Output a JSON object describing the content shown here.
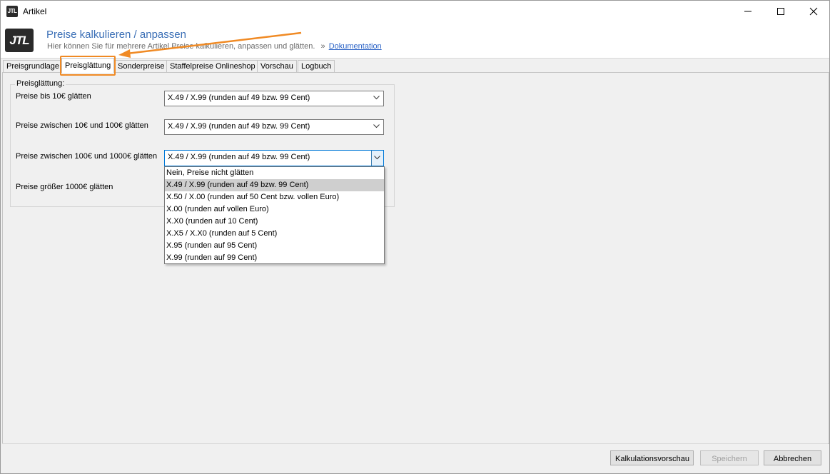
{
  "window": {
    "title": "Artikel",
    "icon": "JTL"
  },
  "header": {
    "logo": "JTL",
    "title": "Preise kalkulieren / anpassen",
    "subtitle": "Hier können Sie für mehrere Artikel Preise kalkulieren, anpassen und glätten.",
    "separator": "»",
    "doc_link": "Dokumentation"
  },
  "tabs": [
    {
      "label": "Preisgrundlage"
    },
    {
      "label": "Preisglättung"
    },
    {
      "label": "Sonderpreise"
    },
    {
      "label": "Staffelpreise Onlineshop"
    },
    {
      "label": "Vorschau"
    },
    {
      "label": "Logbuch"
    }
  ],
  "active_tab": "Preisglättung",
  "group": {
    "legend": "Preisglättung:",
    "rows": [
      {
        "label": "Preise bis 10€ glätten",
        "value": "X.49 / X.99 (runden auf 49 bzw. 99 Cent)"
      },
      {
        "label": "Preise zwischen 10€ und 100€ glätten",
        "value": "X.49 / X.99 (runden auf 49 bzw. 99 Cent)"
      },
      {
        "label": "Preise zwischen 100€ und 1000€ glätten",
        "value": "X.49 / X.99 (runden auf 49 bzw. 99 Cent)"
      },
      {
        "label": "Preise größer 1000€ glätten",
        "value": ""
      }
    ]
  },
  "dropdown_options": [
    "Nein, Preise nicht glätten",
    "X.49 / X.99 (runden auf 49 bzw. 99 Cent)",
    "X.50 / X.00 (runden auf 50 Cent bzw. vollen Euro)",
    "X.00 (runden auf vollen Euro)",
    "X.X0 (runden auf 10 Cent)",
    "X.X5 / X.X0 (runden auf 5 Cent)",
    "X.95 (runden auf 95 Cent)",
    "X.99 (runden auf 99 Cent)"
  ],
  "dropdown_selected": "X.49 / X.99 (runden auf 49 bzw. 99 Cent)",
  "buttons": {
    "preview": "Kalkulationsvorschau",
    "save": "Speichern",
    "cancel": "Abbrechen"
  },
  "colors": {
    "accent_title": "#3b6fb6",
    "highlight_orange": "#f08a24",
    "link": "#2b63c6"
  }
}
